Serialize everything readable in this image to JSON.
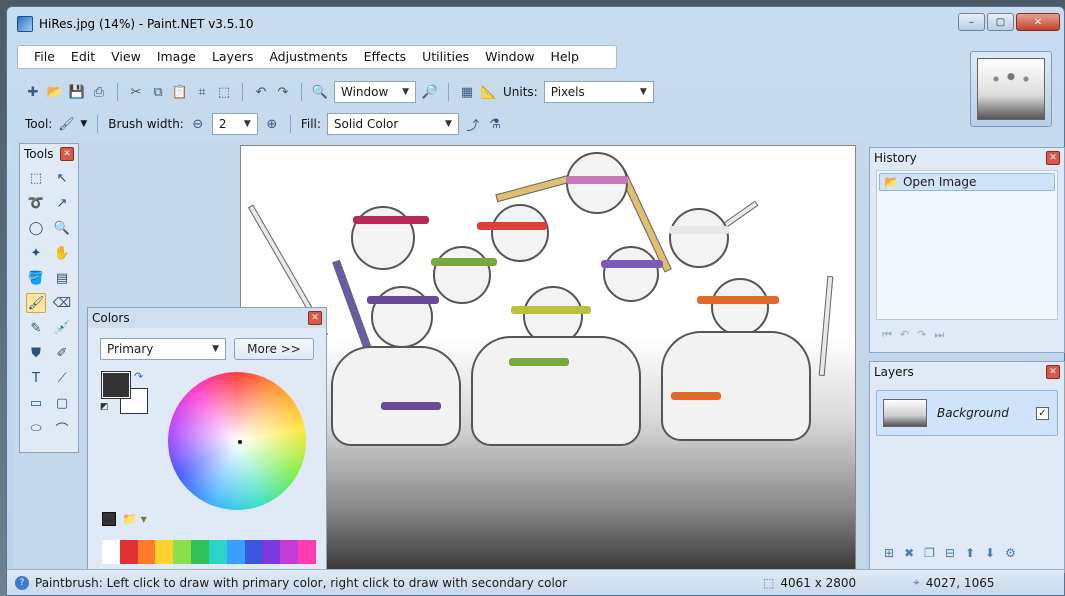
{
  "window": {
    "title": "HiRes.jpg (14%) - Paint.NET v3.5.10",
    "min": "–",
    "max": "▢",
    "close": "✕"
  },
  "menu": [
    "File",
    "Edit",
    "View",
    "Image",
    "Layers",
    "Adjustments",
    "Effects",
    "Utilities",
    "Window",
    "Help"
  ],
  "toolbar": {
    "zoom_value": "Window",
    "units_label": "Units:",
    "units_value": "Pixels"
  },
  "toolbar2": {
    "tool_label": "Tool:",
    "brush_width_label": "Brush width:",
    "brush_width_value": "2",
    "fill_label": "Fill:",
    "fill_value": "Solid Color"
  },
  "tools": {
    "title": "Tools"
  },
  "colors": {
    "title": "Colors",
    "mode": "Primary",
    "more_button": "More >>",
    "primary_color": "#333333",
    "secondary_color": "#ffffff",
    "palette": [
      "#ffffff",
      "#e03030",
      "#ff7a2a",
      "#ffd12e",
      "#8be04a",
      "#33c15a",
      "#2ad6c5",
      "#3aa0ff",
      "#3a58e0",
      "#7a3ae0",
      "#c33ad6",
      "#ff3bb0"
    ]
  },
  "history": {
    "title": "History",
    "items": [
      "Open Image"
    ]
  },
  "layers": {
    "title": "Layers",
    "items": [
      {
        "name": "Background",
        "visible": true
      }
    ]
  },
  "status": {
    "message": "Paintbrush: Left click to draw with primary color, right click to draw with secondary color",
    "image_size": "4061 x 2800",
    "cursor_pos": "4027, 1065"
  }
}
